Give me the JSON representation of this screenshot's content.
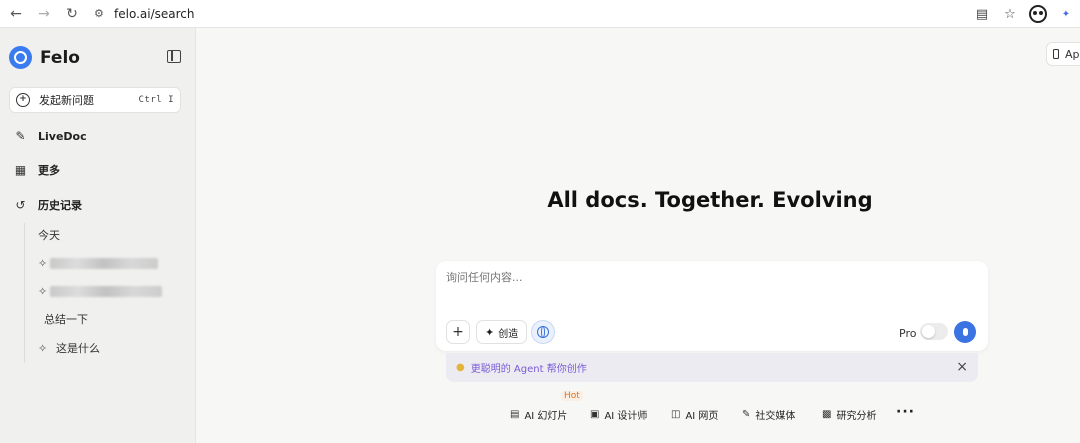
{
  "browser": {
    "url": "felo.ai/search",
    "back_icon": "arrow-left-icon",
    "forward_icon": "arrow-right-icon",
    "reload_icon": "reload-icon"
  },
  "sidebar": {
    "brand": "Felo",
    "new_question": {
      "label": "发起新问题",
      "shortcut": "Ctrl  I"
    },
    "items": [
      {
        "label": "LiveDoc",
        "icon": "edit-icon"
      },
      {
        "label": "更多",
        "icon": "grid-icon"
      },
      {
        "label": "历史记录",
        "icon": "history-icon"
      }
    ],
    "history": {
      "group": "今天",
      "entries": [
        {
          "label": "",
          "blurred": true
        },
        {
          "label": "",
          "blurred": true
        },
        {
          "label": "总结一下",
          "blurred": false
        },
        {
          "label": "这是什么",
          "blurred": false
        }
      ]
    }
  },
  "main": {
    "app_button": "Ap",
    "headline": "All docs. Together. Evolving",
    "search": {
      "placeholder": "询问任何内容...",
      "create_label": "创造",
      "pro_label": "Pro"
    },
    "agent_banner": "更聪明的 Agent 帮你创作",
    "quick_actions": [
      {
        "label": "AI 幻灯片",
        "icon": "slides-icon"
      },
      {
        "label": "AI 设计师",
        "icon": "image-icon"
      },
      {
        "label": "AI 网页",
        "icon": "webpage-icon"
      },
      {
        "label": "社交媒体",
        "icon": "social-icon"
      },
      {
        "label": "研究分析",
        "icon": "research-icon"
      }
    ],
    "hot_tag": "Hot"
  },
  "colors": {
    "accent": "#3b73e3",
    "hot": "#d9772b",
    "agent_text": "#7a5bd8"
  }
}
